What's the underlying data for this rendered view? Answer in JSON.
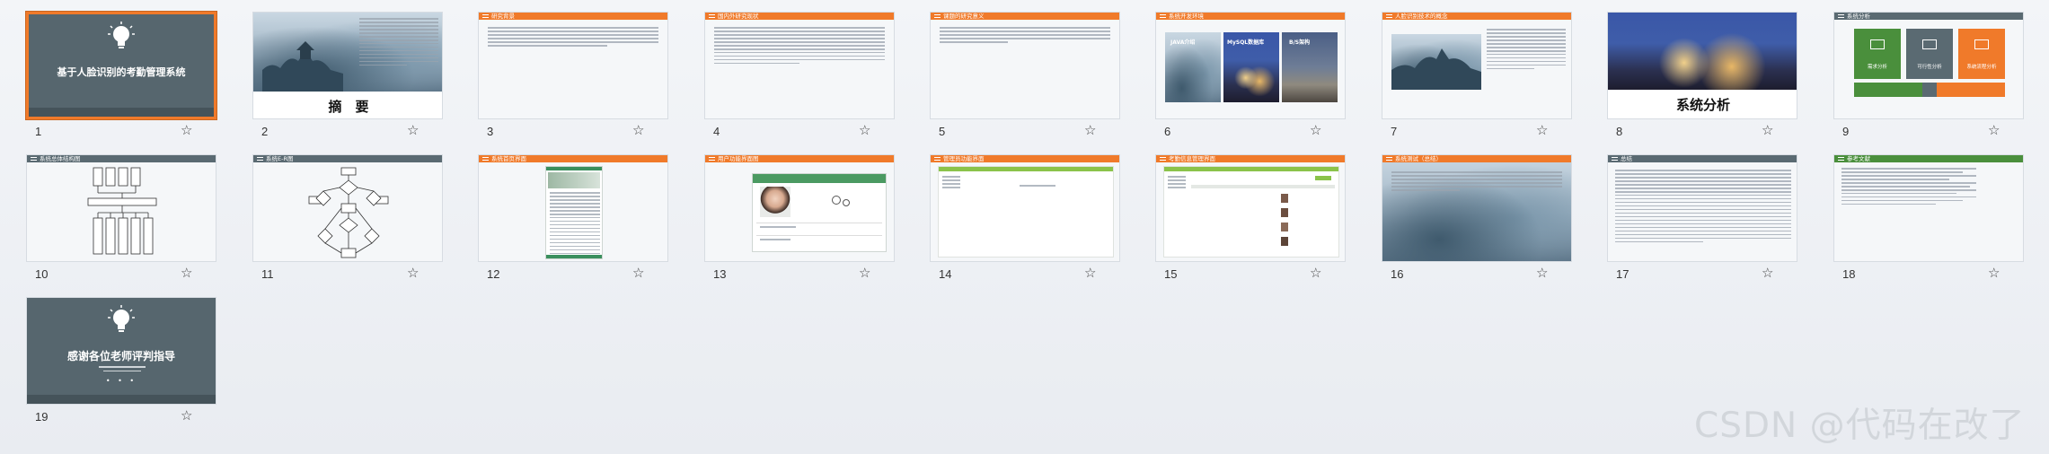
{
  "accent_orange": "#f07a2a",
  "accent_grey": "#5a6a72",
  "accent_green": "#4a8f3c",
  "star_glyph": "☆",
  "watermark": "CSDN @代码在改了",
  "slides": [
    {
      "num": "1",
      "title": "基于人脸识别的考勤管理系统"
    },
    {
      "num": "2",
      "title": "摘　要"
    },
    {
      "num": "3",
      "title": "研究背景"
    },
    {
      "num": "4",
      "title": "国内外研究现状"
    },
    {
      "num": "5",
      "title": "课题的研究意义"
    },
    {
      "num": "6",
      "title": "系统开发环境",
      "boxes": [
        "JAVA介绍",
        "MySQL数据库",
        "B/S架构"
      ]
    },
    {
      "num": "7",
      "title": "人脸识别技术的概念"
    },
    {
      "num": "8",
      "title": "系统分析"
    },
    {
      "num": "9",
      "title": "系统分析",
      "boxes": [
        "需求分析",
        "可行性分析",
        "系统流程分析"
      ]
    },
    {
      "num": "10",
      "title": "系统总体结构图"
    },
    {
      "num": "11",
      "title": "系统E-R图"
    },
    {
      "num": "12",
      "title": "系统首页界面"
    },
    {
      "num": "13",
      "title": "用户功能界面图"
    },
    {
      "num": "14",
      "title": "管理员功能界面"
    },
    {
      "num": "15",
      "title": "考勤信息管理界面"
    },
    {
      "num": "16",
      "title": "系统测试（总结）"
    },
    {
      "num": "17",
      "title": "总结"
    },
    {
      "num": "18",
      "title": "参考文献"
    },
    {
      "num": "19",
      "title": "感谢各位老师评判指导"
    }
  ]
}
